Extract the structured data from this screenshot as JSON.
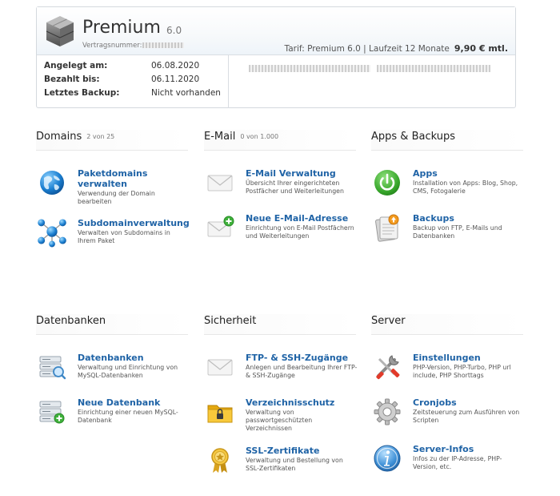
{
  "product": {
    "name": "Premium",
    "version": "6.0",
    "contract_label": "Vertragsnummer:",
    "tarif_text": "Tarif: Premium 6.0  |  Laufzeit 12 Monate",
    "price": "9,90 € mtl."
  },
  "info": {
    "rows": [
      {
        "label": "Angelegt am:",
        "value": "06.08.2020"
      },
      {
        "label": "Bezahlt bis:",
        "value": "06.11.2020"
      },
      {
        "label": "Letztes Backup:",
        "value": "Nicht vorhanden"
      }
    ]
  },
  "sections": {
    "domains": {
      "title": "Domains",
      "count": "2 von 25",
      "items": [
        {
          "title": "Paketdomains verwalten",
          "desc": "Verwendung der Domain bearbeiten",
          "icon": "globe-icon"
        },
        {
          "title": "Subdomainverwaltung",
          "desc": "Verwalten von Subdomains in Ihrem Paket",
          "icon": "network-globes-icon"
        }
      ]
    },
    "email": {
      "title": "E-Mail",
      "count": "0 von 1.000",
      "items": [
        {
          "title": "E-Mail Verwaltung",
          "desc": "Übersicht Ihrer eingerichteten Postfächer und Weiterleitungen",
          "icon": "envelope-icon"
        },
        {
          "title": "Neue E-Mail-Adresse",
          "desc": "Einrichtung von E-Mail Postfächern und Weiterleitungen",
          "icon": "envelope-add-icon"
        }
      ]
    },
    "apps": {
      "title": "Apps & Backups",
      "items": [
        {
          "title": "Apps",
          "desc": "Installation von Apps: Blog, Shop, CMS, Fotogalerie",
          "icon": "power-icon"
        },
        {
          "title": "Backups",
          "desc": "Backup von FTP, E-Mails und Datenbanken",
          "icon": "backup-icon"
        }
      ]
    },
    "databases": {
      "title": "Datenbanken",
      "items": [
        {
          "title": "Datenbanken",
          "desc": "Verwaltung und Einrichtung von MySQL-Datenbanken",
          "icon": "database-search-icon"
        },
        {
          "title": "Neue Datenbank",
          "desc": "Einrichtung einer neuen MySQL-Datenbank",
          "icon": "database-add-icon"
        }
      ]
    },
    "security": {
      "title": "Sicherheit",
      "items": [
        {
          "title": "FTP- & SSH-Zugänge",
          "desc": "Anlegen und Bearbeitung Ihrer FTP- & SSH-Zugänge",
          "icon": "envelope-icon"
        },
        {
          "title": "Verzeichnisschutz",
          "desc": "Verwaltung von passwortgeschützten Verzeichnissen",
          "icon": "locked-folder-icon"
        },
        {
          "title": "SSL-Zertifikate",
          "desc": "Verwaltung und Bestellung von SSL-Zertifikaten",
          "icon": "certificate-icon"
        }
      ]
    },
    "server": {
      "title": "Server",
      "items": [
        {
          "title": "Einstellungen",
          "desc": "PHP-Version, PHP-Turbo, PHP url include, PHP Shorttags",
          "icon": "tools-icon"
        },
        {
          "title": "Cronjobs",
          "desc": "Zeitsteuerung zum Ausführen von Scripten",
          "icon": "gear-icon"
        },
        {
          "title": "Server-Infos",
          "desc": "Infos zu der IP-Adresse, PHP-Version, etc.",
          "icon": "info-icon"
        }
      ]
    }
  }
}
